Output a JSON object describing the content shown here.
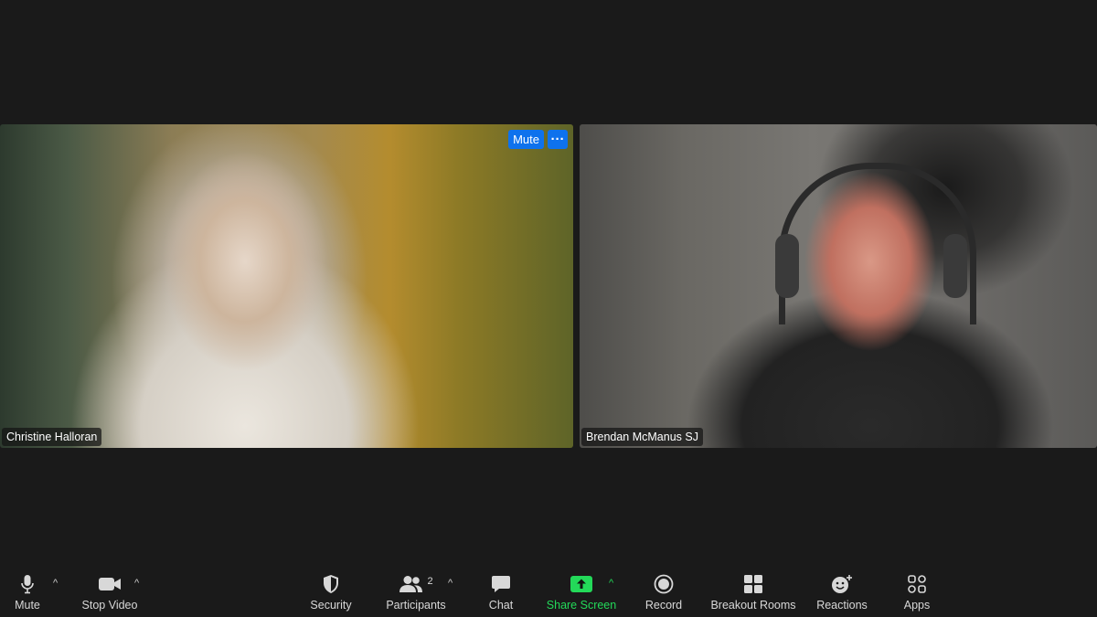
{
  "participants": [
    {
      "name": "Christine Halloran",
      "mute_label": "Mute",
      "more_label": "···"
    },
    {
      "name": "Brendan McManus SJ"
    }
  ],
  "toolbar": {
    "mute": "Mute",
    "stop_video": "Stop Video",
    "security": "Security",
    "participants": "Participants",
    "participants_count": "2",
    "chat": "Chat",
    "share_screen": "Share Screen",
    "record": "Record",
    "breakout_rooms": "Breakout Rooms",
    "reactions": "Reactions",
    "apps": "Apps"
  },
  "icons": {
    "mute": "microphone-icon",
    "stop_video": "video-camera-icon",
    "security": "shield-icon",
    "participants": "people-icon",
    "chat": "chat-bubble-icon",
    "share_screen": "share-screen-icon",
    "record": "record-icon",
    "breakout_rooms": "grid-icon",
    "reactions": "smiley-icon",
    "apps": "apps-icon"
  },
  "colors": {
    "background": "#1a1a1a",
    "accent_blue": "#0e72ed",
    "share_green": "#23d959"
  }
}
